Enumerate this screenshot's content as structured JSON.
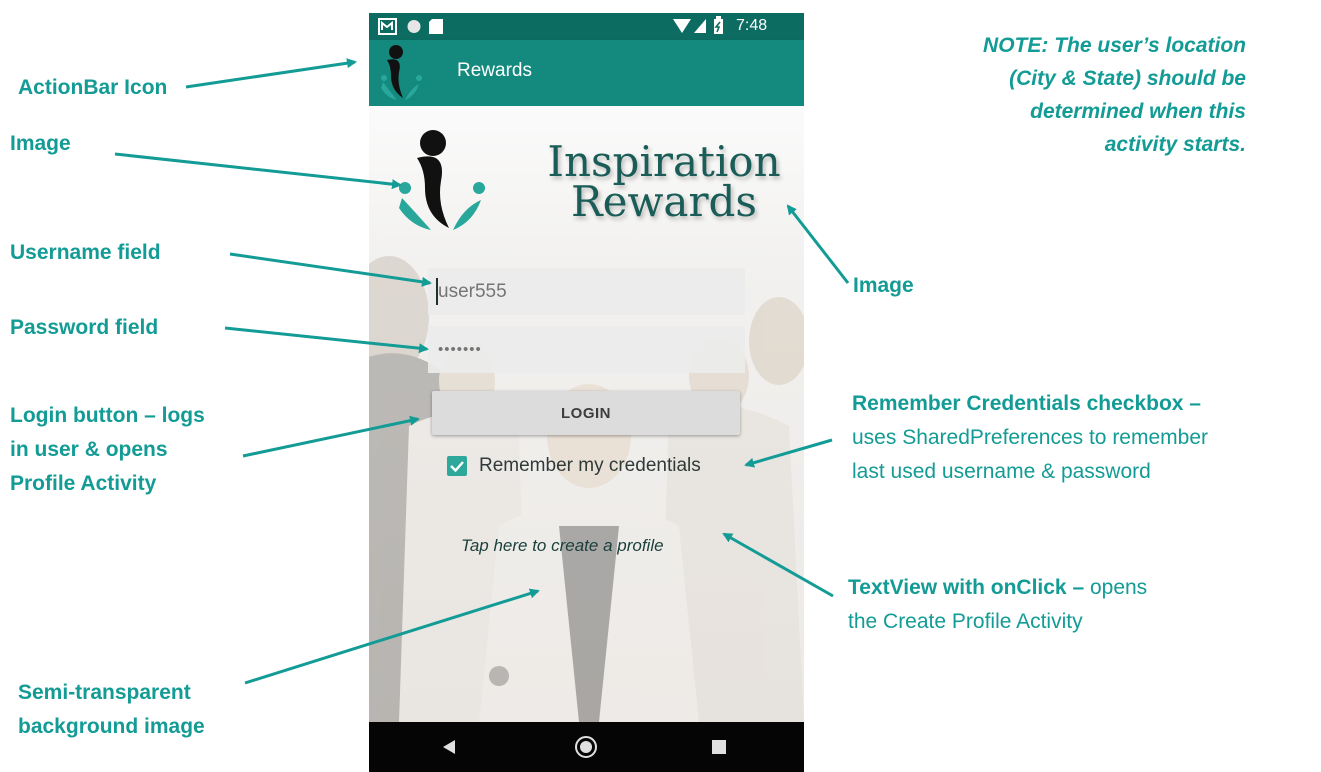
{
  "annotations": {
    "actionbar_icon": "ActionBar Icon",
    "image_left": "Image",
    "image_right": "Image",
    "username_field": "Username field",
    "password_field": "Password field",
    "login_button_line1": "Login button – logs",
    "login_button_line2": "in user & opens",
    "login_button_line3": "Profile Activity",
    "remember_bold": "Remember Credentials checkbox",
    "remember_dash": " –",
    "remember_line2": "uses SharedPreferences to remember",
    "remember_line3": "last used username & password",
    "textview_bold": "TextView with onClick",
    "textview_dash": "  –",
    "textview_rest1": " opens",
    "textview_line2": "the Create Profile Activity",
    "bg_line1": "Semi-transparent",
    "bg_line2": "background image",
    "note_line1": "NOTE: The user’s location",
    "note_line2": "(City & State) should be",
    "note_line3": "determined when this",
    "note_line4": "activity starts."
  },
  "status_bar": {
    "time": "7:48"
  },
  "action_bar": {
    "title": "Rewards",
    "icon": "inspiration-logo-icon"
  },
  "logo": {
    "line1": "Inspiration",
    "line2": "Rewards"
  },
  "form": {
    "username_value": "user555",
    "password_value": "•••••••",
    "login_label": "LOGIN",
    "remember_label": "Remember my credentials",
    "remember_checked": true,
    "create_profile_link": "Tap here to create a profile"
  },
  "colors": {
    "annotation": "#139b95",
    "status_bar": "#0c6c62",
    "action_bar": "#14897d",
    "checkbox": "#2fa89c"
  }
}
